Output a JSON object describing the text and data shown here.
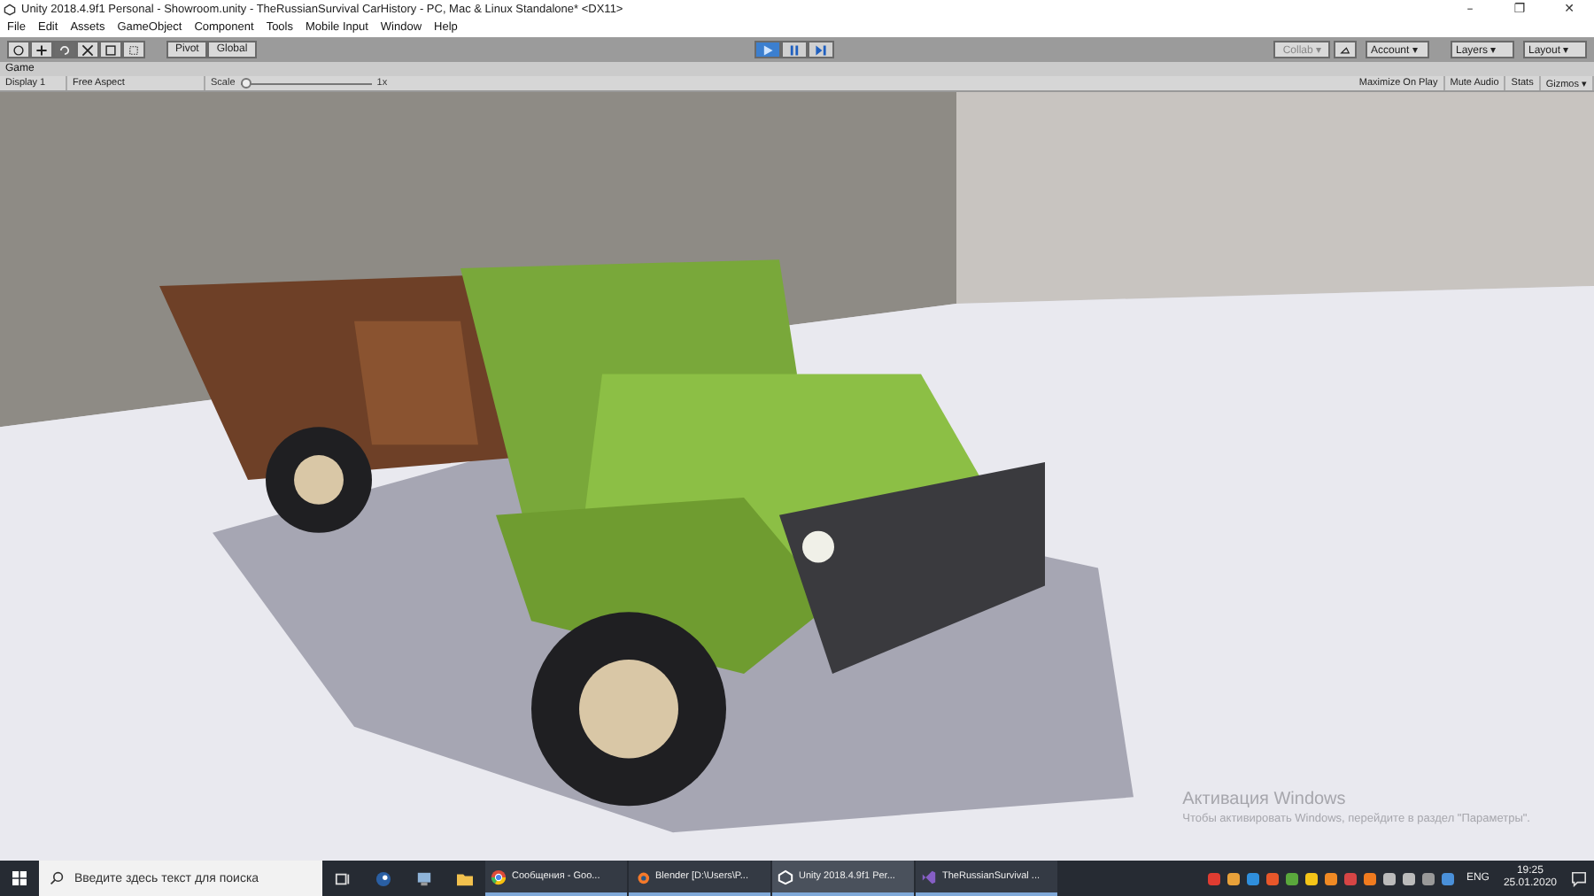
{
  "window": {
    "title": "Unity 2018.4.9f1 Personal - Showroom.unity - TheRussianSurvival CarHistory - PC, Mac & Linux Standalone* <DX11>",
    "controls": [
      "–",
      "❐",
      "✕"
    ]
  },
  "menu": [
    "File",
    "Edit",
    "Assets",
    "GameObject",
    "Component",
    "Tools",
    "Mobile Input",
    "Window",
    "Help"
  ],
  "toolbar": {
    "tools": [
      {
        "kind": "hand",
        "selected": false
      },
      {
        "kind": "move",
        "selected": false
      },
      {
        "kind": "rotate",
        "selected": true
      },
      {
        "kind": "scale",
        "selected": false
      },
      {
        "kind": "rect",
        "selected": false
      },
      {
        "kind": "transform",
        "selected": false
      }
    ],
    "pivot": "Pivot",
    "global": "Global",
    "playback": [
      {
        "kind": "play",
        "selected": true
      },
      {
        "kind": "pause",
        "selected": false
      },
      {
        "kind": "step",
        "selected": false
      }
    ],
    "collab": "Collab ▾",
    "account": "Account ▾",
    "layers": "Layers ▾",
    "layout": "Layout ▾"
  },
  "game_tab": {
    "label": "Game"
  },
  "game_bar": {
    "display": "Display 1",
    "aspect": "Free Aspect",
    "scale_label": "Scale",
    "scale": {
      "level": 0.0
    },
    "scale_value": "1x",
    "toggles": [
      {
        "label": "Maximize On Play",
        "on": false
      },
      {
        "label": "Mute Audio",
        "on": false
      },
      {
        "label": "Stats",
        "on": false
      },
      {
        "label": "Gizmos ▾",
        "on": false
      }
    ]
  },
  "game_view": {
    "kind": "picture",
    "activation_title": "Активация Windows",
    "activation_text": "Чтобы активировать Windows, перейдите в раздел \"Параметры\"."
  },
  "taskbar": {
    "search": {
      "placeholder": "Введите здесь текст для поиска"
    },
    "pinned": [
      {
        "kind": "task-view"
      },
      {
        "kind": "steam"
      },
      {
        "kind": "monitor"
      },
      {
        "kind": "folder"
      }
    ],
    "windows": [
      {
        "kind": "chrome",
        "label": "Сообщения - Goo...",
        "selected": false
      },
      {
        "kind": "blender",
        "label": "Blender [D:\\Users\\P...",
        "selected": false
      },
      {
        "kind": "unity",
        "label": "Unity 2018.4.9f1 Per...",
        "selected": true
      },
      {
        "kind": "vs",
        "label": "TheRussianSurvival ...",
        "selected": false
      }
    ],
    "language": "ENG",
    "time": "19:25",
    "date": "25.01.2020"
  }
}
